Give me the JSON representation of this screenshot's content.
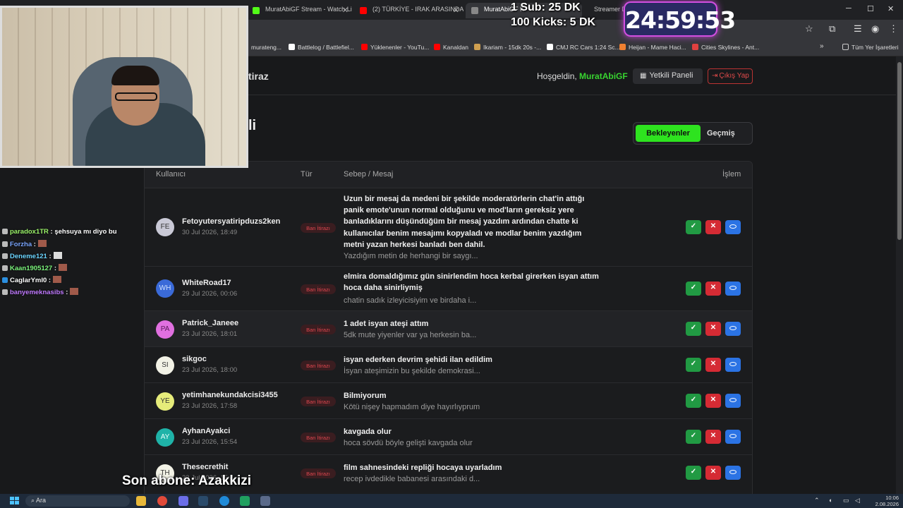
{
  "browser": {
    "tabs": [
      {
        "label": "MuratAbiGF Stream - Watch Li",
        "color": "#53fc18"
      },
      {
        "label": "(2) TÜRKİYE - IRAK ARASINDAK",
        "color": "#ff0000"
      },
      {
        "label": "MuratAbiGF K",
        "color": "#888888"
      },
      {
        "label": "Streamer Dashboard",
        "color": "#888888"
      }
    ],
    "bookmarks": [
      {
        "label": "murateng...",
        "color": "#888888"
      },
      {
        "label": "Battlelog / Battlefiel...",
        "color": "#ffffff"
      },
      {
        "label": "Yüklenenler - YouTu...",
        "color": "#ff0000"
      },
      {
        "label": "Kanaldan",
        "color": "#ff0000"
      },
      {
        "label": "Ikariam - 15dk 20s -...",
        "color": "#d0a050"
      },
      {
        "label": "CMJ RC Cars 1:24 Sc...",
        "color": "#ffffff"
      },
      {
        "label": "Heijan - Mame Haci...",
        "color": "#f08030"
      },
      {
        "label": "Cities Skylines - Ant...",
        "color": "#e04040"
      }
    ],
    "all_bookmarks_label": "Tüm Yer İşaretleri"
  },
  "header": {
    "brand": "tiraz",
    "welcome_prefix": "Hoşgeldin,",
    "username": "MuratAbiGF",
    "panel_button": "Yetkili Paneli",
    "logout_button": "Çıkış Yap"
  },
  "page": {
    "title": "li",
    "filter_active": "Bekleyenler",
    "filter_other": "Geçmiş"
  },
  "table": {
    "headers": {
      "user": "Kullanıcı",
      "type": "Tür",
      "reason": "Sebep / Mesaj",
      "action": "İşlem"
    },
    "rows": [
      {
        "initials": "FE",
        "avatar_color": "#c9c9d6",
        "user": "Fetoyutersyatiripduzs2ken",
        "date": "30 Jul 2026, 18:49",
        "type": "Ban İtirazı",
        "title": "Uzun bir mesaj da medeni bir şekilde moderatörlerin chat'in attığı panik emote'unun normal olduğunu ve mod'ların gereksiz yere banladıklarını düşündüğüm bir mesaj yazdım ardından chatte ki kullanıcılar benim mesajımı kopyaladı ve modlar benim yazdığım metni yazan herkesi banladı ben dahil.",
        "detail": "Yazdığım metin de herhangi bir saygı..."
      },
      {
        "initials": "WH",
        "avatar_color": "#3a6ad8",
        "user": "WhiteRoad17",
        "date": "29 Jul 2026, 00:06",
        "type": "Ban İtirazı",
        "title": "elmira domaldığımız gün sinirlendim hoca kerbal girerken isyan attım hoca daha sinirliymiş",
        "detail": "chatin sadık izleyicisiyim ve birdaha i..."
      },
      {
        "initials": "PA",
        "avatar_color": "#e070e0",
        "user": "Patrick_Janeee",
        "date": "23 Jul 2026, 18:01",
        "type": "Ban İtirazı",
        "title": "1 adet isyan ateşi attım",
        "detail": "5dk mute yiyenler var ya herkesin ba..."
      },
      {
        "initials": "SI",
        "avatar_color": "#f2f2e6",
        "user": "sikgoc",
        "date": "23 Jul 2026, 18:00",
        "type": "Ban İtirazı",
        "title": "isyan ederken devrim şehidi ilan edildim",
        "detail": "İsyan ateşimizin bu şekilde demokrasi..."
      },
      {
        "initials": "YE",
        "avatar_color": "#e6ec7a",
        "user": "yetimhanekundakcisi3455",
        "date": "23 Jul 2026, 17:58",
        "type": "Ban İtirazı",
        "title": "Bilmiyorum",
        "detail": "Kötü nişey hapmadım diye hayırlıyprum"
      },
      {
        "initials": "AY",
        "avatar_color": "#1fb3a8",
        "user": "AyhanAyakci",
        "date": "23 Jul 2026, 15:54",
        "type": "Ban İtirazı",
        "title": "kavgada olur",
        "detail": "hoca sövdü böyle gelişti kavgada olur"
      },
      {
        "initials": "TH",
        "avatar_color": "#f2f2e6",
        "user": "Thesecrethit",
        "date": "23 Jul 2026, 15:4",
        "type": "Ban İtirazı",
        "title": "film sahnesindeki repliği hocaya uyarladım",
        "detail": "recep ivdedikle babanesi arasındaki d..."
      }
    ]
  },
  "overlay": {
    "goal_sub": "1 Sub: 25 DK",
    "goal_kicks": "100 Kicks: 5 DK",
    "timer": "24:59:53",
    "last_sub": "Son abone: Azakkizi",
    "chat": [
      {
        "user": "paradox1TR",
        "color": "#9cf56a",
        "message": "şehsuya mı diyo bu"
      },
      {
        "user": "Forzha",
        "color": "#7aa6ff",
        "message": ""
      },
      {
        "user": "Deneme121",
        "color": "#6ad4ff",
        "message": ""
      },
      {
        "user": "Kaan1905127",
        "color": "#7cf57c",
        "message": ""
      },
      {
        "user": "CaglarYml0",
        "color": "#ffffff",
        "message": ""
      },
      {
        "user": "banyemeknasibs",
        "color": "#c07aff",
        "message": ""
      }
    ]
  },
  "taskbar": {
    "search_placeholder": "Ara",
    "time": "10:06",
    "date": "2.08.2026"
  }
}
